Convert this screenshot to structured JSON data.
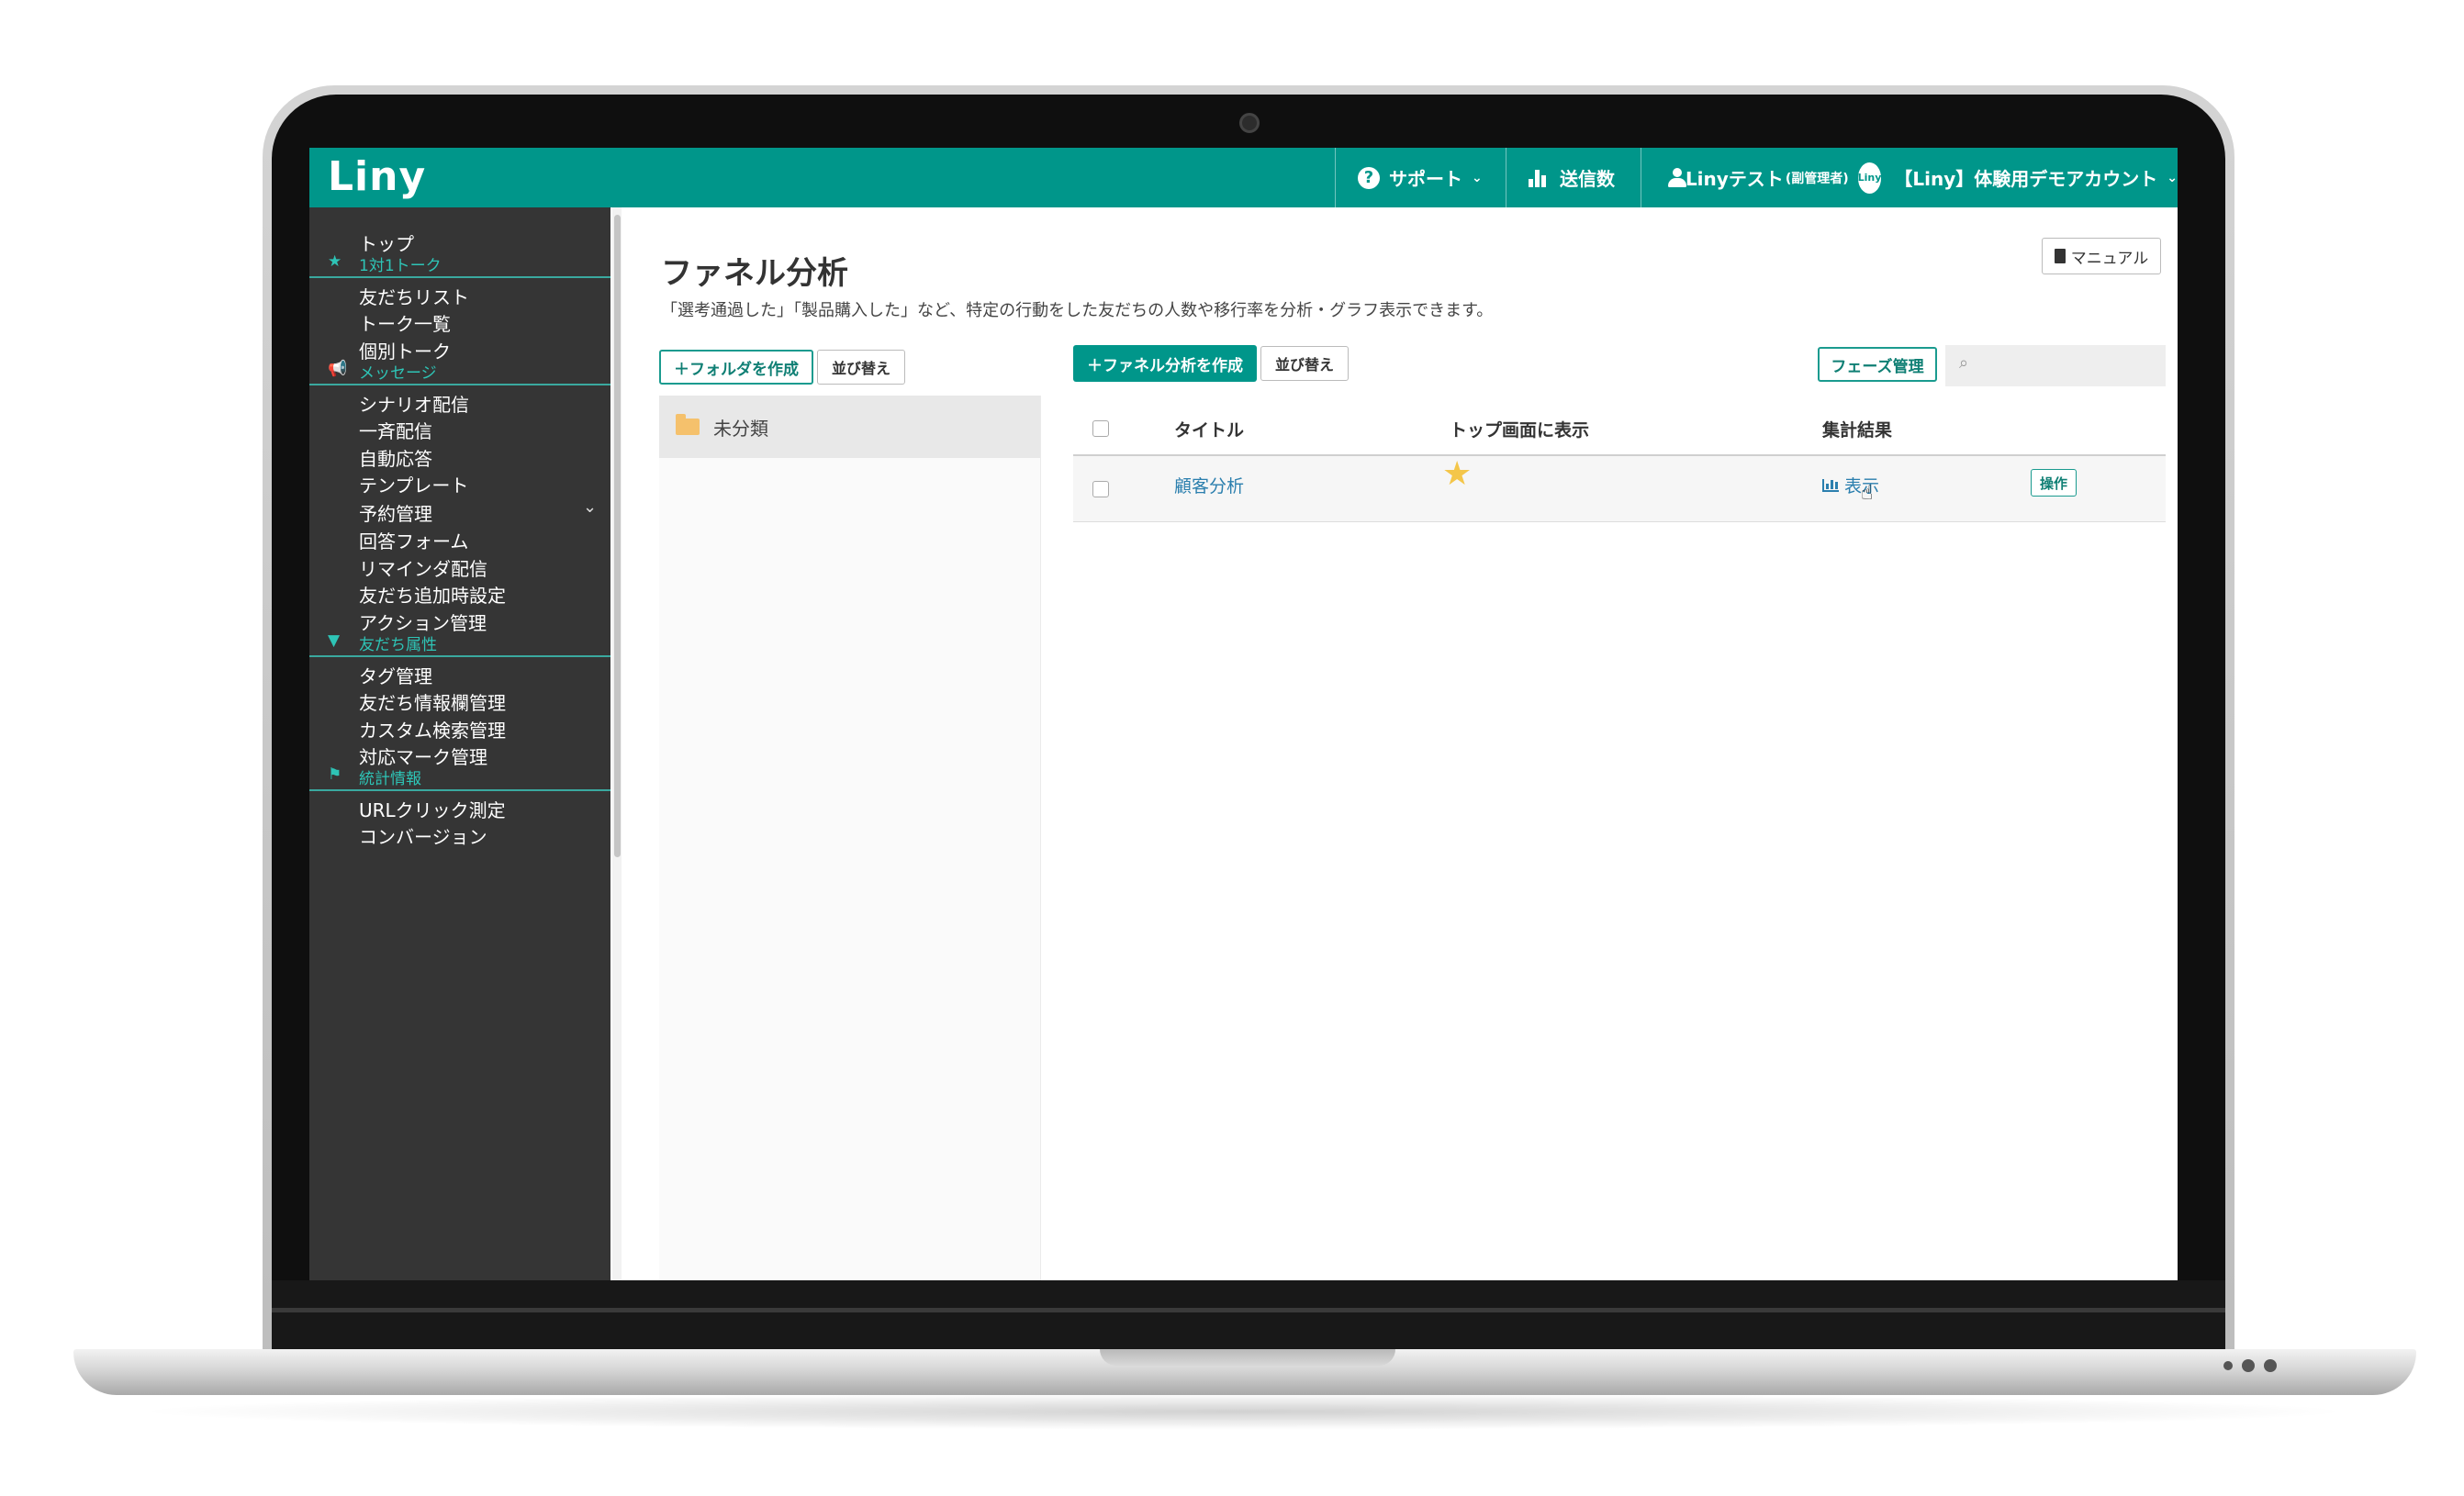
{
  "header": {
    "logo": "Liny",
    "support": "サポート",
    "sent_count": "送信数",
    "user_name": "Linyテスト",
    "user_role": "(副管理者)",
    "account_logo": "Liny",
    "account_name": "【Liny】体験用デモアカウント"
  },
  "sidebar": {
    "top": "トップ",
    "sections": [
      {
        "label": "1対1トーク",
        "items": [
          "友だちリスト",
          "トーク一覧",
          "個別トーク"
        ]
      },
      {
        "label": "メッセージ",
        "items": [
          "シナリオ配信",
          "一斉配信",
          "自動応答",
          "テンプレート",
          "予約管理",
          "回答フォーム",
          "リマインダ配信",
          "友だち追加時設定",
          "アクション管理"
        ]
      },
      {
        "label": "友だち属性",
        "items": [
          "タグ管理",
          "友だち情報欄管理",
          "カスタム検索管理",
          "対応マーク管理"
        ]
      },
      {
        "label": "統計情報",
        "items": [
          "URLクリック測定",
          "コンバージョン"
        ]
      }
    ]
  },
  "main": {
    "title": "ファネル分析",
    "description": "「選考通過した」「製品購入した」など、特定の行動をした友だちの人数や移行率を分析・グラフ表示できます。",
    "manual_label": "マニュアル",
    "create_folder_label": "フォルダを作成",
    "sort_label": "並び替え",
    "create_funnel_label": "ファネル分析を作成",
    "phase_manage_label": "フェーズ管理",
    "search_placeholder": "",
    "folder": "未分類",
    "table": {
      "headers": [
        "タイトル",
        "トップ画面に表示",
        "集計結果"
      ],
      "rows": [
        {
          "title": "顧客分析",
          "show_on_top": true,
          "result_label": "表示",
          "action_label": "操作"
        }
      ]
    }
  },
  "colors": {
    "brand": "#00968a",
    "sidebar_bg": "#353535",
    "section_accent": "#2ec4b6",
    "link": "#2b7fae",
    "star": "#f4c64a"
  }
}
